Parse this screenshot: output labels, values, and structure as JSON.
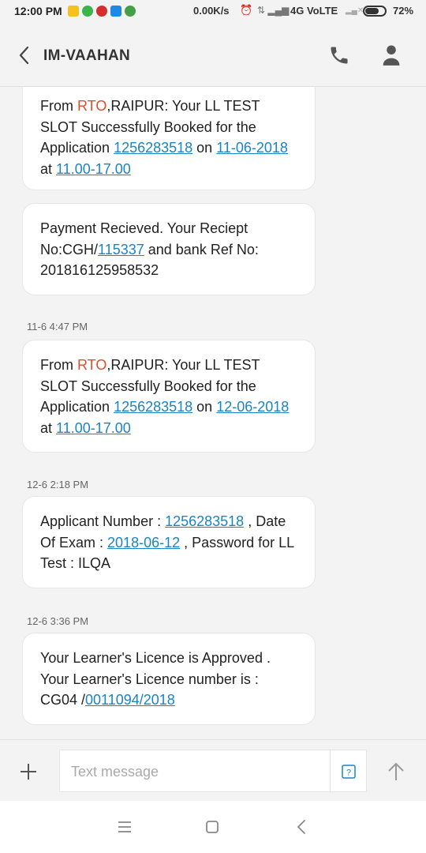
{
  "status_bar": {
    "time": "12:00 PM",
    "net_speed": "0.00K/s",
    "network": "4G VoLTE",
    "battery": "72%",
    "battery_level": 0.72,
    "notification_icons": [
      "flash-icon",
      "whatsapp-icon",
      "jio-icon",
      "app-icon",
      "shield-icon"
    ]
  },
  "header": {
    "title": "IM-VAAHAN",
    "icons": [
      "back-icon",
      "call-icon",
      "person-icon"
    ]
  },
  "messages": [
    {
      "timestamp": "",
      "parts": [
        {
          "t": "From "
        },
        {
          "t": "RTO",
          "s": "sender"
        },
        {
          "t": ",RAIPUR: Your LL TEST SLOT Successfully Booked for the Application "
        },
        {
          "t": "1256283518",
          "s": "link"
        },
        {
          "t": " on "
        },
        {
          "t": "11-06-2018",
          "s": "link"
        },
        {
          "t": " at "
        },
        {
          "t": "11.00-17.00",
          "s": "link"
        }
      ]
    },
    {
      "timestamp": "",
      "parts": [
        {
          "t": "Payment Recieved. Your Reciept No:CGH/"
        },
        {
          "t": "115337",
          "s": "link"
        },
        {
          "t": " and bank Ref No: 201816125958532"
        }
      ]
    },
    {
      "timestamp": "11-6 4:47 PM",
      "parts": [
        {
          "t": "From "
        },
        {
          "t": "RTO",
          "s": "sender"
        },
        {
          "t": ",RAIPUR: Your LL TEST SLOT Successfully Booked for the Application "
        },
        {
          "t": "1256283518",
          "s": "link"
        },
        {
          "t": " on "
        },
        {
          "t": "12-06-2018",
          "s": "link"
        },
        {
          "t": " at "
        },
        {
          "t": "11.00-17.00",
          "s": "link"
        }
      ]
    },
    {
      "timestamp": "12-6 2:18 PM",
      "parts": [
        {
          "t": "Applicant Number : "
        },
        {
          "t": "1256283518",
          "s": "link"
        },
        {
          "t": " , Date Of Exam : "
        },
        {
          "t": "2018-06-12",
          "s": "link"
        },
        {
          "t": " , Password for LL Test : ILQA"
        }
      ]
    },
    {
      "timestamp": "12-6 3:36 PM",
      "parts": [
        {
          "t": "Your Learner's Licence is Approved . Your Learner's Licence number is : CG04 /"
        },
        {
          "t": "0011094/2018",
          "s": "link"
        }
      ]
    }
  ],
  "composer": {
    "placeholder": "Text message",
    "icons": [
      "plus-icon",
      "sim-icon",
      "send-arrow-icon"
    ]
  },
  "nav": {
    "icons": [
      "menu-icon",
      "home-square-icon",
      "back-triangle-icon"
    ]
  },
  "colors": {
    "background": "#f3f3f3",
    "bubble": "#ffffff",
    "link": "#1a84c7",
    "sender": "#d9502b"
  }
}
